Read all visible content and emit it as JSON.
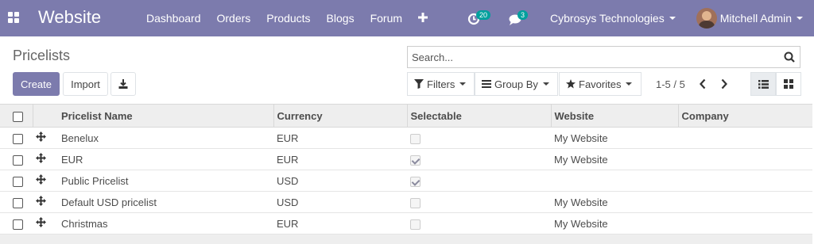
{
  "navbar": {
    "brand": "Website",
    "menu": [
      "Dashboard",
      "Orders",
      "Products",
      "Blogs",
      "Forum"
    ],
    "plus_icon": "plus-icon",
    "activity_count": "20",
    "messages_count": "3",
    "company": "Cybrosys Technologies",
    "user": "Mitchell Admin",
    "colors": {
      "bar": "#7c7bad",
      "badge": "#00a09d"
    }
  },
  "control": {
    "title": "Pricelists",
    "create_label": "Create",
    "import_label": "Import",
    "search_placeholder": "Search...",
    "filters_label": "Filters",
    "groupby_label": "Group By",
    "favorites_label": "Favorites",
    "pager": "1-5 / 5"
  },
  "table": {
    "columns": [
      "Pricelist Name",
      "Currency",
      "Selectable",
      "Website",
      "Company"
    ],
    "rows": [
      {
        "name": "Benelux",
        "currency": "EUR",
        "selectable": false,
        "website": "My Website",
        "company": ""
      },
      {
        "name": "EUR",
        "currency": "EUR",
        "selectable": true,
        "website": "My Website",
        "company": ""
      },
      {
        "name": "Public Pricelist",
        "currency": "USD",
        "selectable": true,
        "website": "",
        "company": ""
      },
      {
        "name": "Default USD pricelist",
        "currency": "USD",
        "selectable": false,
        "website": "My Website",
        "company": ""
      },
      {
        "name": "Christmas",
        "currency": "EUR",
        "selectable": false,
        "website": "My Website",
        "company": ""
      }
    ]
  }
}
